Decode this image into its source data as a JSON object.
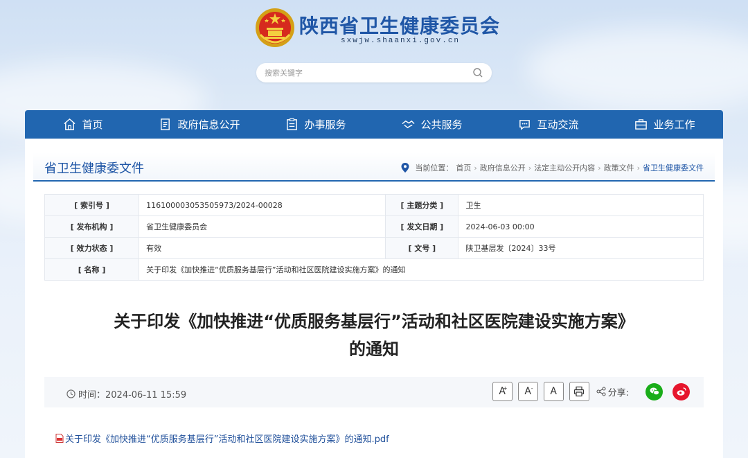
{
  "header": {
    "site_title": "陕西省卫生健康委员会",
    "site_domain": "sxwjw.shaanxi.gov.cn",
    "search_placeholder": "搜索关键字"
  },
  "nav": {
    "items": [
      {
        "label": "首页",
        "icon": "home-icon"
      },
      {
        "label": "政府信息公开",
        "icon": "document-list-icon"
      },
      {
        "label": "办事服务",
        "icon": "clipboard-icon"
      },
      {
        "label": "公共服务",
        "icon": "handshake-icon"
      },
      {
        "label": "互动交流",
        "icon": "chat-bubble-icon"
      },
      {
        "label": "业务工作",
        "icon": "briefcase-icon"
      }
    ]
  },
  "section": {
    "title": "省卫生健康委文件",
    "breadcrumb_label": "当前位置：",
    "breadcrumb": [
      "首页",
      "政府信息公开",
      "法定主动公开内容",
      "政策文件",
      "省卫生健康委文件"
    ]
  },
  "meta": {
    "index_key": "[ 索引号 ]",
    "index_value": "11610000305350597­3/2024-00028",
    "topic_key": "[ 主题分类 ]",
    "topic_value": "卫生",
    "issuer_key": "[ 发布机构 ]",
    "issuer_value": "省卫生健康委员会",
    "date_key": "[ 发文日期 ]",
    "date_value": "2024-06-03 00:00",
    "status_key": "[ 效力状态 ]",
    "status_value": "有效",
    "docno_key": "[ 文号 ]",
    "docno_value": "陕卫基层发〔2024〕33号",
    "name_key": "[ 名称 ]",
    "name_value": "关于印发《加快推进“优质服务基层行”活动和社区医院建设实施方案》的通知"
  },
  "article": {
    "title_line1": "关于印发《加快推进“优质服务基层行”活动和社区医院建设实施方案》",
    "title_line2": "的通知",
    "time": "时间：2024-06-11 15:59",
    "font_large": "A",
    "font_small": "A",
    "font_normal": "A",
    "share_label": "分享:",
    "attachment": "关于印发《加快推进“优质服务基层行”活动和社区医院建设实施方案》的通知.pdf"
  },
  "colors": {
    "nav_bg": "#2166b0",
    "title_blue": "#1f56a6",
    "valid_green": "#2e8b2e",
    "wechat_green": "#1aad19",
    "weibo_red": "#e6162d"
  }
}
